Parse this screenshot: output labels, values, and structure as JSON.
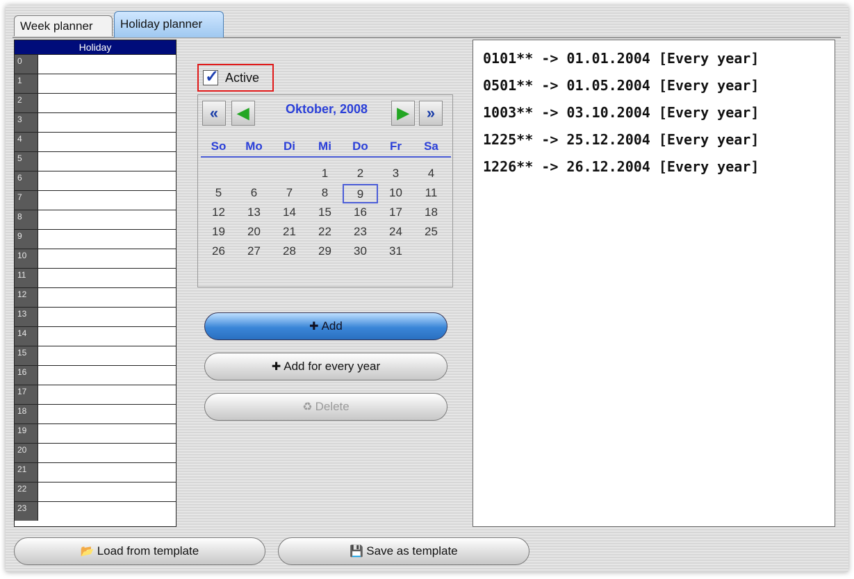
{
  "tabs": [
    {
      "label": "Week planner",
      "active": false
    },
    {
      "label": "Holiday planner",
      "active": true
    }
  ],
  "hours_table": {
    "header": "Holiday",
    "rows": [
      "0",
      "1",
      "2",
      "3",
      "4",
      "5",
      "6",
      "7",
      "8",
      "9",
      "10",
      "11",
      "12",
      "13",
      "14",
      "15",
      "16",
      "17",
      "18",
      "19",
      "20",
      "21",
      "22",
      "23"
    ]
  },
  "active_checkbox": {
    "label": "Active",
    "checked": true
  },
  "calendar": {
    "title": "Oktober, 2008",
    "weekdays": [
      "So",
      "Mo",
      "Di",
      "Mi",
      "Do",
      "Fr",
      "Sa"
    ],
    "weeks": [
      [
        "",
        "",
        "",
        "1",
        "2",
        "3",
        "4"
      ],
      [
        "5",
        "6",
        "7",
        "8",
        "9",
        "10",
        "11"
      ],
      [
        "12",
        "13",
        "14",
        "15",
        "16",
        "17",
        "18"
      ],
      [
        "19",
        "20",
        "21",
        "22",
        "23",
        "24",
        "25"
      ],
      [
        "26",
        "27",
        "28",
        "29",
        "30",
        "31",
        ""
      ]
    ],
    "selected_day": "9",
    "icons": {
      "prev_year": "double-left-arrow-icon",
      "prev_month": "left-arrow-icon",
      "next_month": "right-arrow-icon",
      "next_year": "double-right-arrow-icon"
    }
  },
  "buttons": {
    "add": "Add",
    "add_every_year": "Add for every year",
    "delete": "Delete",
    "load_template": "Load from template",
    "save_template": "Save as template"
  },
  "holidays": [
    "0101** -> 01.01.2004 [Every year]",
    "0501** -> 01.05.2004 [Every year]",
    "1003** -> 03.10.2004 [Every year]",
    "1225** -> 25.12.2004 [Every year]",
    "1226** -> 26.12.2004 [Every year]"
  ],
  "colors": {
    "header_bg": "#000c7a",
    "calendar_accent": "#2a3fd8",
    "active_highlight": "#e01818"
  }
}
